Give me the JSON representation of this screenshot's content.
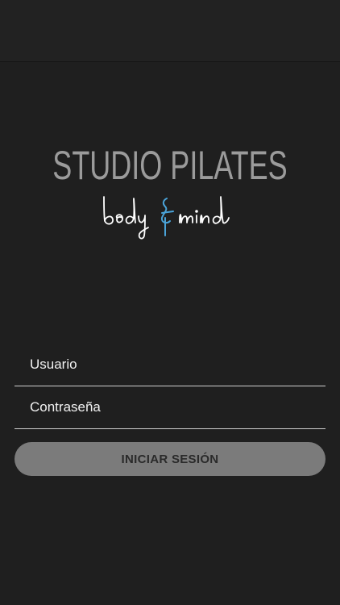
{
  "logo": {
    "title": "STUDIO PILATES",
    "script_wordmark": "body&mind"
  },
  "login": {
    "username_placeholder": "Usuario",
    "password_placeholder": "Contraseña",
    "submit_label": "INICIAR SESIÓN"
  },
  "colors": {
    "background": "#1f1f1f",
    "field_underline": "#cfcfcf",
    "button_fill": "#7b7b7b",
    "logo_accent": "#4aa3d8"
  }
}
